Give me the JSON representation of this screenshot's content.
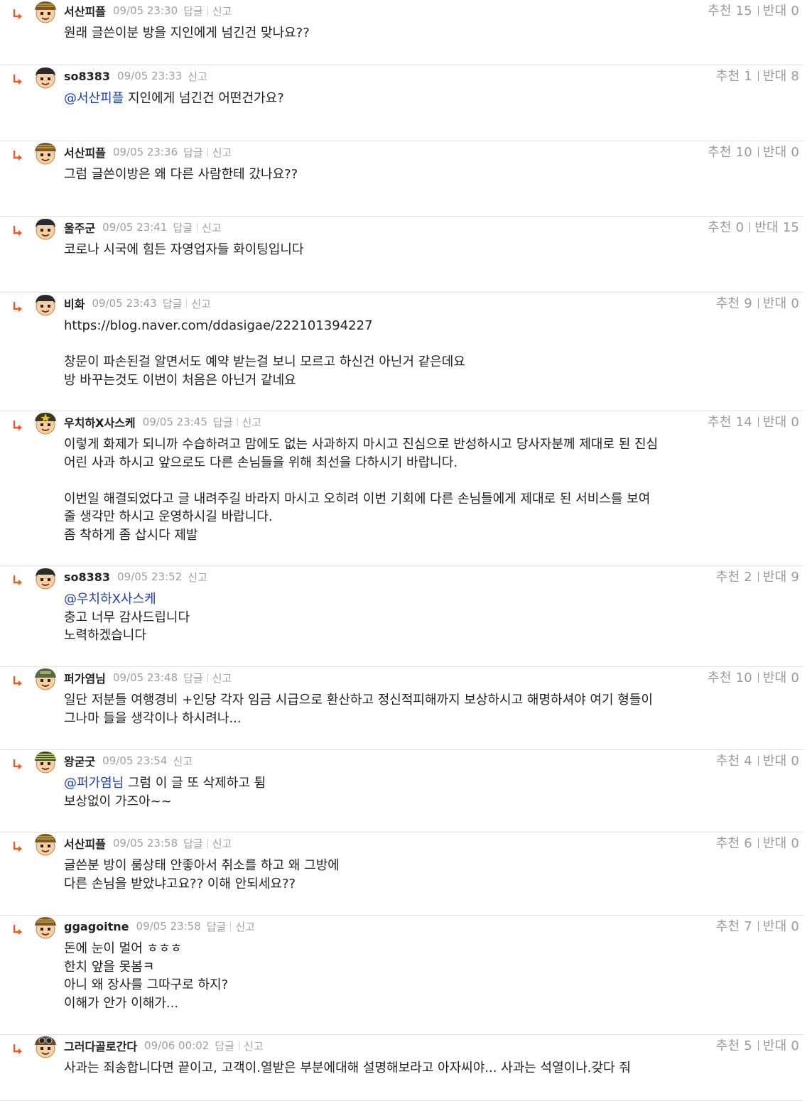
{
  "accent_colors": {
    "reply_arrow": "#ee5a24",
    "mention": "#1a3fb4",
    "meta_text": "#a0a0a0",
    "divider": "#e2e2e2"
  },
  "labels": {
    "reply": "답글",
    "report": "신고",
    "recommend": "추천",
    "oppose": "반대"
  },
  "comments": [
    {
      "author": "서산피플",
      "date": "09/05 23:30",
      "has_reply": true,
      "up": "15",
      "down": "0",
      "lines": [
        {
          "mention": "",
          "text": "원래 글쓴이분 방을 지인에게 넘긴건 맞나요??"
        }
      ]
    },
    {
      "author": "so8383",
      "date": "09/05 23:33",
      "has_reply": false,
      "up": "1",
      "down": "8",
      "lines": [
        {
          "mention": "@서산피플",
          "text": " 지인에게 넘긴건 어떤건가요?"
        }
      ]
    },
    {
      "author": "서산피플",
      "date": "09/05 23:36",
      "has_reply": true,
      "up": "10",
      "down": "0",
      "lines": [
        {
          "mention": "",
          "text": "그럼 글쓴이방은 왜 다른 사람한테 갔나요??"
        }
      ]
    },
    {
      "author": "울주군",
      "date": "09/05 23:41",
      "has_reply": true,
      "up": "0",
      "down": "15",
      "lines": [
        {
          "mention": "",
          "text": "코로나 시국에 힘든 자영업자들 화이팅입니다"
        }
      ]
    },
    {
      "author": "비화",
      "date": "09/05 23:43",
      "has_reply": true,
      "up": "9",
      "down": "0",
      "lines": [
        {
          "mention": "",
          "text": "https://blog.naver.com/ddasigae/222101394227"
        },
        {
          "mention": "",
          "text": ""
        },
        {
          "mention": "",
          "text": "창문이 파손된걸 알면서도 예약 받는걸 보니 모르고 하신건 아닌거 같은데요"
        },
        {
          "mention": "",
          "text": "방 바꾸는것도 이번이 처음은 아닌거 같네요"
        }
      ]
    },
    {
      "author": "우치하X사스케",
      "date": "09/05 23:45",
      "has_reply": true,
      "up": "14",
      "down": "0",
      "lines": [
        {
          "mention": "",
          "text": "이렇게 화제가 되니까 수습하려고 맘에도 없는 사과하지 마시고 진심으로 반성하시고 당사자분께 제대로 된 진심"
        },
        {
          "mention": "",
          "text": "어린 사과 하시고 앞으로도 다른 손님들을 위해 최선을 다하시기 바랍니다."
        },
        {
          "mention": "",
          "text": ""
        },
        {
          "mention": "",
          "text": "이번일 해결되었다고 글 내려주길 바라지 마시고 오히려 이번 기회에 다른 손님들에게 제대로 된 서비스를 보여"
        },
        {
          "mention": "",
          "text": "줄 생각만 하시고 운영하시길 바랍니다."
        },
        {
          "mention": "",
          "text": "좀 착하게 좀 삽시다 제발"
        }
      ]
    },
    {
      "author": "so8383",
      "date": "09/05 23:52",
      "has_reply": false,
      "up": "2",
      "down": "9",
      "lines": [
        {
          "mention": "@우치하X사스케",
          "text": ""
        },
        {
          "mention": "",
          "text": "충고 너무 감사드립니다"
        },
        {
          "mention": "",
          "text": "노력하겠습니다"
        }
      ]
    },
    {
      "author": "퍼가염님",
      "date": "09/05 23:48",
      "has_reply": true,
      "up": "10",
      "down": "0",
      "lines": [
        {
          "mention": "",
          "text": "일단 저분들 여행경비 +인당 각자 임금 시급으로 환산하고 정신적피해까지 보상하시고 해명하셔야 여기 형들이"
        },
        {
          "mention": "",
          "text": "그나마 들을 생각이나 하시려나..."
        }
      ]
    },
    {
      "author": "왕굳굿",
      "date": "09/05 23:54",
      "has_reply": false,
      "up": "4",
      "down": "0",
      "lines": [
        {
          "mention": "@퍼가염님",
          "text": " 그럼 이 글 또 삭제하고 튐"
        },
        {
          "mention": "",
          "text": "보상없이 가즈아~~"
        }
      ]
    },
    {
      "author": "서산피플",
      "date": "09/05 23:58",
      "has_reply": true,
      "up": "6",
      "down": "0",
      "lines": [
        {
          "mention": "",
          "text": "글쓴분 방이 룸상태 안좋아서 취소를 하고 왜 그방에"
        },
        {
          "mention": "",
          "text": "다른 손님을 받았냐고요?? 이해 안되세요??"
        }
      ]
    },
    {
      "author": "ggagoitne",
      "date": "09/05 23:58",
      "has_reply": true,
      "up": "7",
      "down": "0",
      "lines": [
        {
          "mention": "",
          "text": "돈에 눈이 멀어 ㅎㅎㅎ"
        },
        {
          "mention": "",
          "text": "한치 앞을 못봄ㅋ"
        },
        {
          "mention": "",
          "text": "아니 왜 장사를 그따구로 하지?"
        },
        {
          "mention": "",
          "text": "이해가 안가 이해가..."
        }
      ]
    },
    {
      "author": "그러다골로간다",
      "date": "09/06 00:02",
      "has_reply": true,
      "up": "5",
      "down": "0",
      "lines": [
        {
          "mention": "",
          "text": "사과는 죄송합니다면 끝이고, 고객이.열받은 부분에대해 설명해보라고 아자씨야... 사과는 석열이나.갖다 줘"
        }
      ]
    }
  ]
}
